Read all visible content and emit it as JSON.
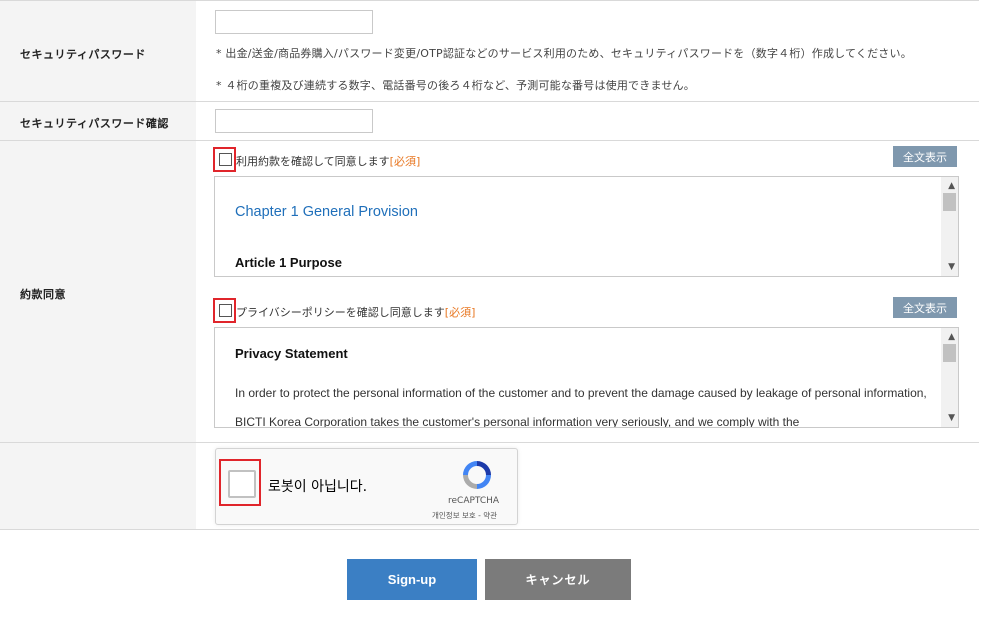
{
  "security_password": {
    "label": "セキュリティパスワード",
    "input_value": "",
    "note1": "* 出金/送金/商品券購入/パスワード変更/OTP認証などのサービス利用のため、セキュリティパスワードを（数字４桁）作成してください。",
    "note2": "* ４桁の重複及び連続する数字、電話番号の後ろ４桁など、予測可能な番号は使用できません。"
  },
  "security_password_confirm": {
    "label": "セキュリティパスワード確認",
    "input_value": ""
  },
  "terms": {
    "label": "約款同意",
    "terms_agree": {
      "label": "利用約款を確認して同意します",
      "required": "[必須]",
      "fulltext_button": "全文表示",
      "heading": "Chapter 1 General Provision",
      "article": "Article 1 Purpose"
    },
    "privacy_agree": {
      "label": "プライバシーポリシーを確認し同意します",
      "required": "[必須]",
      "fulltext_button": "全文表示",
      "heading": "Privacy Statement",
      "body": "In order to protect the personal information of the customer and to prevent the damage caused by leakage of personal information, BICTI Korea Corporation takes the customer's personal information very seriously, and we comply with the"
    }
  },
  "captcha": {
    "label": "로봇이 아닙니다.",
    "brand": "reCAPTCHA",
    "links": "개인정보 보호 - 약관"
  },
  "buttons": {
    "signup": "Sign-up",
    "cancel": "キャンセル"
  },
  "colors": {
    "accent": "#3b7fc4",
    "required": "#e87722",
    "highlight": "#e0252b",
    "fulltext_button": "#7f98ae"
  }
}
